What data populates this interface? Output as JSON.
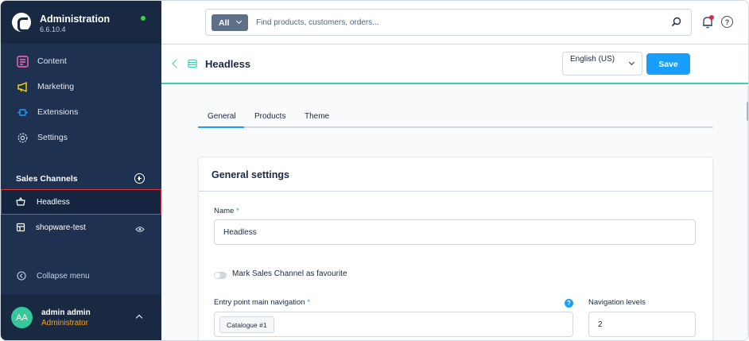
{
  "app": {
    "title": "Administration",
    "version": "6.6.10.4",
    "status_color": "#37d046"
  },
  "sidebar": {
    "nav": [
      {
        "label": "Content",
        "icon": "content-icon",
        "color": "#ff68b4"
      },
      {
        "label": "Marketing",
        "icon": "megaphone-icon",
        "color": "#ffd700"
      },
      {
        "label": "Extensions",
        "icon": "plug-icon",
        "color": "#189eff"
      },
      {
        "label": "Settings",
        "icon": "gear-icon",
        "color": "#c6d1de"
      }
    ],
    "sales_channels_label": "Sales Channels",
    "channels": [
      {
        "label": "Headless",
        "icon": "basket-icon",
        "active": true
      },
      {
        "label": "shopware-test",
        "icon": "storefront-icon",
        "active": false
      }
    ],
    "collapse_label": "Collapse menu"
  },
  "user": {
    "initials": "AA",
    "name": "admin admin",
    "role": "Administrator"
  },
  "search": {
    "type_label": "All",
    "placeholder": "Find products, customers, orders..."
  },
  "smartbar": {
    "title": "Headless",
    "language": "English (US)",
    "save_label": "Save"
  },
  "tabs": [
    {
      "label": "General",
      "active": true
    },
    {
      "label": "Products",
      "active": false
    },
    {
      "label": "Theme",
      "active": false
    }
  ],
  "card": {
    "title": "General settings",
    "name_label": "Name",
    "name_value": "Headless",
    "favourite_label": "Mark Sales Channel as favourite",
    "entry_point_label": "Entry point main navigation",
    "entry_point_value": "Catalogue #1",
    "nav_levels_label": "Navigation levels",
    "nav_levels_value": "2",
    "required_mark": "*",
    "help_mark": "?"
  },
  "colors": {
    "sidebar_bg": "#1f3150",
    "accent": "#189eff",
    "teal": "#37d0b0",
    "active_outline": "#e0353b"
  }
}
